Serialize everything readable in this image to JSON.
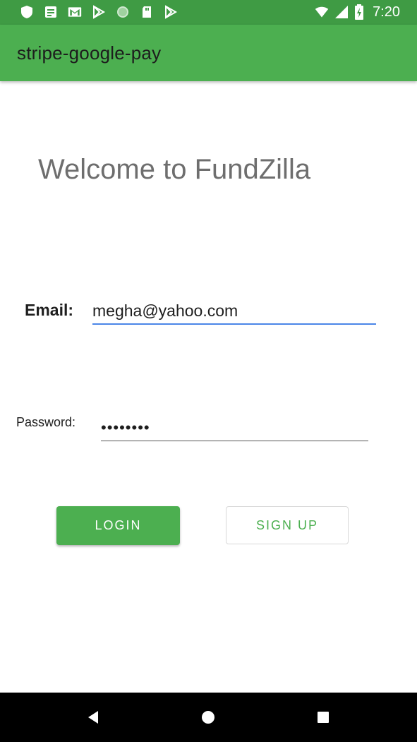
{
  "status_bar": {
    "time": "7:20",
    "left_icons": [
      "shield-icon",
      "notes-icon",
      "gmail-icon",
      "play-store-icon",
      "circle-icon",
      "sd-card-icon",
      "play-store-icon"
    ],
    "right_icons": [
      "wifi-icon",
      "cell-signal-icon",
      "battery-charging-icon"
    ]
  },
  "app_bar": {
    "title": "stripe-google-pay"
  },
  "main": {
    "welcome": "Welcome to FundZilla",
    "email_label": "Email:",
    "email_value": "megha@yahoo.com",
    "password_label": "Password:",
    "password_value": "••••••••",
    "login_label": "LOGIN",
    "signup_label": "SIGN UP"
  },
  "colors": {
    "primary": "#4caf50",
    "primary_dark": "#3f9b44",
    "input_focus": "#4a86e8"
  }
}
